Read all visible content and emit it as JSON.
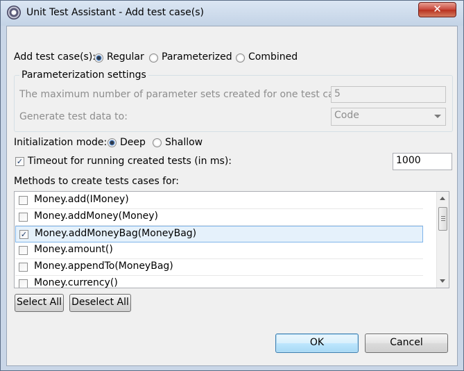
{
  "window": {
    "title": "Unit Test Assistant - Add test case(s)",
    "close_glyph": "✕"
  },
  "add_test_cases": {
    "label": "Add test case(s):",
    "options": [
      {
        "label": "Regular",
        "checked": true
      },
      {
        "label": "Parameterized",
        "checked": false
      },
      {
        "label": "Combined",
        "checked": false
      }
    ]
  },
  "parameterization": {
    "title": "Parameterization settings",
    "max_sets_label": "The maximum number of parameter sets created for one test case:",
    "max_sets_value": "5",
    "generate_label": "Generate test data to:",
    "generate_value": "Code"
  },
  "initialization": {
    "label": "Initialization mode:",
    "options": [
      {
        "label": "Deep",
        "checked": true
      },
      {
        "label": "Shallow",
        "checked": false
      }
    ]
  },
  "timeout": {
    "label": "Timeout for running created tests (in ms):",
    "checked": true,
    "value": "1000"
  },
  "methods": {
    "label": "Methods to create tests cases for:",
    "items": [
      {
        "label": "Money.add(IMoney)",
        "checked": false
      },
      {
        "label": "Money.addMoney(Money)",
        "checked": false
      },
      {
        "label": "Money.addMoneyBag(MoneyBag)",
        "checked": true
      },
      {
        "label": "Money.amount()",
        "checked": false
      },
      {
        "label": "Money.appendTo(MoneyBag)",
        "checked": false
      },
      {
        "label": "Money.currency()",
        "checked": false
      }
    ]
  },
  "buttons": {
    "select_all": "Select All",
    "deselect_all": "Deselect All",
    "ok": "OK",
    "cancel": "Cancel"
  }
}
